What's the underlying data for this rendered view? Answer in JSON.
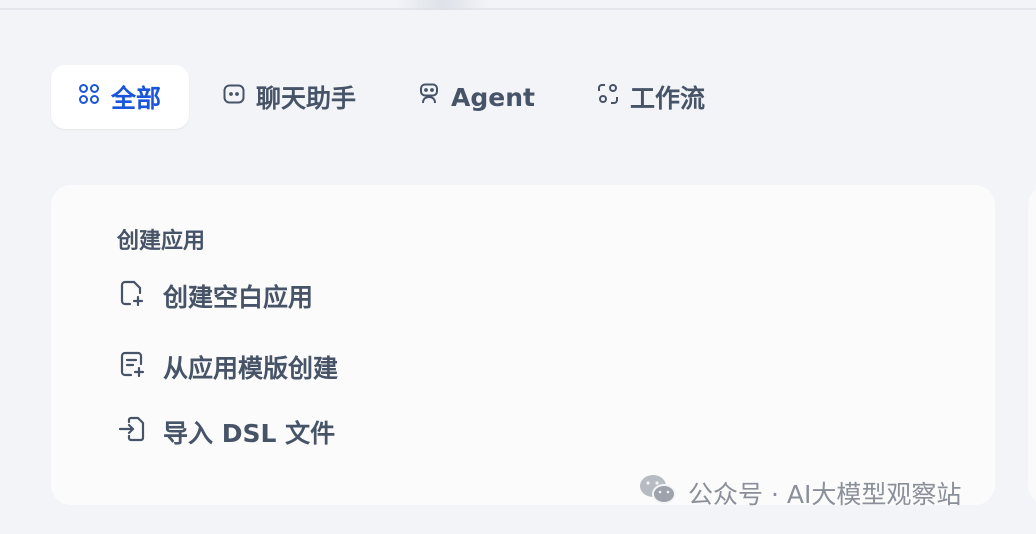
{
  "tabs": [
    {
      "label": "全部",
      "icon": "grid-icon",
      "active": true
    },
    {
      "label": "聊天助手",
      "icon": "chat-bubble-icon",
      "active": false
    },
    {
      "label": "Agent",
      "icon": "robot-icon",
      "active": false
    },
    {
      "label": "工作流",
      "icon": "workflow-icon",
      "active": false
    }
  ],
  "create": {
    "section_title": "创建应用",
    "actions": [
      {
        "label": "创建空白应用",
        "icon": "file-plus-icon"
      },
      {
        "label": "从应用模版创建",
        "icon": "file-template-icon"
      },
      {
        "label": "导入 DSL 文件",
        "icon": "file-import-icon"
      }
    ]
  },
  "watermark": {
    "text": "公众号 · AI大模型观察站",
    "icon": "wechat-icon"
  },
  "colors": {
    "accent": "#1a56db",
    "background": "#f2f4f7",
    "card": "#fbfbfc",
    "text": "#475467"
  }
}
